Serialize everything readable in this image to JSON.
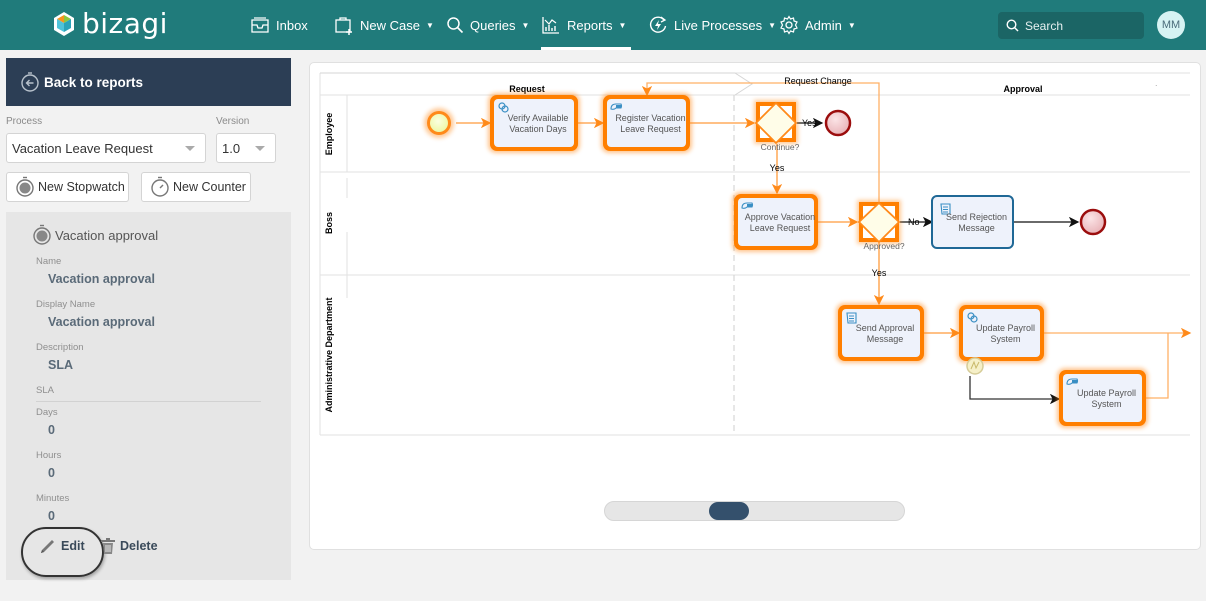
{
  "app": {
    "brand": "bizagi",
    "user_initials": "MM"
  },
  "nav": {
    "items": [
      {
        "label": "Inbox",
        "icon": "inbox-icon",
        "has_dropdown": false
      },
      {
        "label": "New Case",
        "icon": "new-case-icon",
        "has_dropdown": true
      },
      {
        "label": "Queries",
        "icon": "search-icon",
        "has_dropdown": true
      },
      {
        "label": "Reports",
        "icon": "reports-chart-icon",
        "has_dropdown": true,
        "active": true
      },
      {
        "label": "Live Processes",
        "icon": "live-processes-icon",
        "has_dropdown": true
      },
      {
        "label": "Admin",
        "icon": "gear-icon",
        "has_dropdown": true
      }
    ],
    "search_placeholder": "Search"
  },
  "sidebar": {
    "back_label": "Back to reports",
    "process_label": "Process",
    "process_value": "Vacation Leave Request",
    "version_label": "Version",
    "version_value": "1.0",
    "new_stopwatch_label": "New Stopwatch",
    "new_counter_label": "New Counter",
    "detail": {
      "title": "Vacation approval",
      "fields": [
        {
          "label": "Name",
          "value": "Vacation approval"
        },
        {
          "label": "Display Name",
          "value": "Vacation approval"
        },
        {
          "label": "Description",
          "value": "SLA"
        }
      ],
      "sla_label": "SLA",
      "sla": [
        {
          "label": "Days",
          "value": "0"
        },
        {
          "label": "Hours",
          "value": "0"
        },
        {
          "label": "Minutes",
          "value": "0"
        }
      ],
      "edit_label": "Edit",
      "delete_label": "Delete"
    }
  },
  "diagram": {
    "phases": [
      "Request",
      "Approval"
    ],
    "lanes": [
      "Employee",
      "Boss",
      "Administrative Department"
    ],
    "tasks": [
      {
        "id": "t1",
        "label": [
          "Verify Available",
          "Vacation Days"
        ],
        "type": "service",
        "highlighted": true
      },
      {
        "id": "t2",
        "label": [
          "Register Vacation",
          "Leave Request"
        ],
        "type": "user",
        "highlighted": true
      },
      {
        "id": "t3",
        "label": [
          "Approve Vacation",
          "Leave Request"
        ],
        "type": "user",
        "highlighted": true
      },
      {
        "id": "t4",
        "label": [
          "Send Rejection",
          "Message"
        ],
        "type": "script",
        "highlighted": false
      },
      {
        "id": "t5",
        "label": [
          "Send Approval",
          "Message"
        ],
        "type": "script",
        "highlighted": true
      },
      {
        "id": "t6",
        "label": [
          "Update Payroll",
          "System"
        ],
        "type": "service",
        "highlighted": true
      },
      {
        "id": "t7",
        "label": [
          "Update Payroll",
          "System"
        ],
        "type": "user",
        "highlighted": true
      }
    ],
    "gateways": [
      {
        "id": "g1",
        "label": "Continue?"
      },
      {
        "id": "g2",
        "label": "Approved?"
      }
    ],
    "flow_labels": {
      "request_change": "Request Change",
      "continue_yes_end": "Yes",
      "continue_yes_down": "Yes",
      "approved_no": "No",
      "approved_yes": "Yes"
    },
    "colors": {
      "highlight": "#ff7f00",
      "task_fill": "#eef2fb",
      "end_event": "#8b0000"
    }
  }
}
